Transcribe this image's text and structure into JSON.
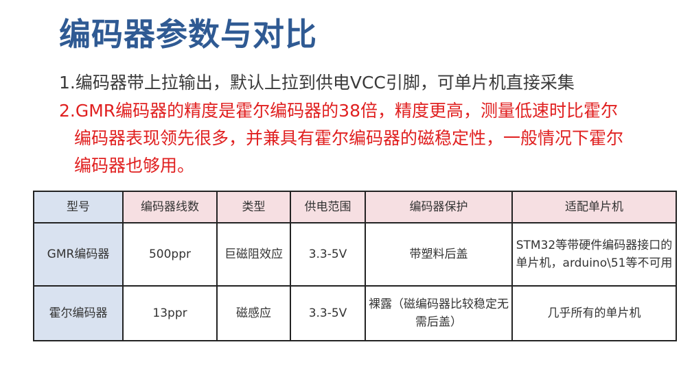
{
  "title": "编码器参数与对比",
  "lines": [
    "1.编码器带上拉输出，默认上拉到供电VCC引脚，可单片机直接采集",
    "2.GMR编码器的精度是霍尔编码器的38倍，精度更高，测量低速时比霍尔",
    "编码器表现领先很多，并兼具有霍尔编码器的磁稳定性，一般情况下霍尔",
    "编码器也够用。"
  ],
  "colors": {
    "title": "#2f5a93",
    "text": "#3a3a3a",
    "highlight": "#e02020",
    "header_blue": "#d9e2f0",
    "header_pink": "#f6dfe2"
  },
  "table": {
    "headers": [
      "型号",
      "编码器线数",
      "类型",
      "供电范围",
      "编码器保护",
      "适配单片机"
    ],
    "rows": [
      [
        "GMR编码器",
        "500ppr",
        "巨磁阻效应",
        "3.3-5V",
        "带塑料后盖",
        "STM32等带硬件编码器接口的单片机，arduino\\51等不可用"
      ],
      [
        "霍尔编码器",
        "13ppr",
        "磁感应",
        "3.3-5V",
        "裸露（磁编码器比较稳定无需后盖）",
        "几乎所有的单片机"
      ]
    ]
  }
}
